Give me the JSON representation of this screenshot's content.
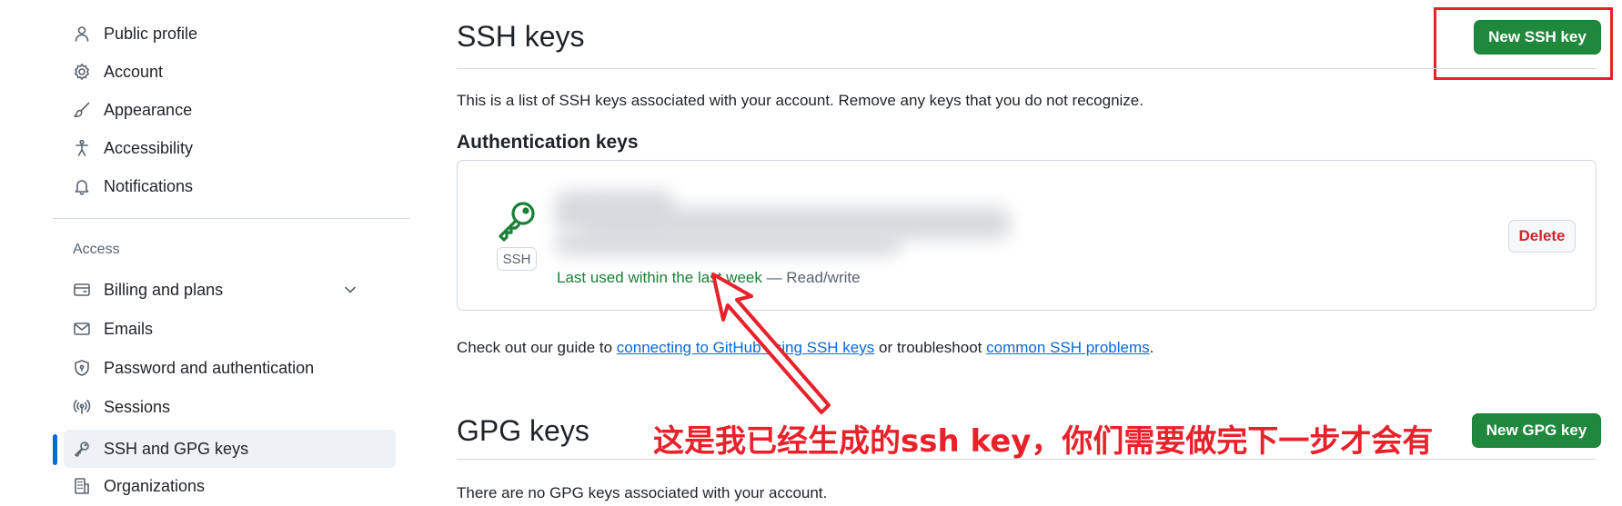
{
  "sidebar": {
    "items": [
      {
        "label": "Public profile",
        "icon": "person-icon"
      },
      {
        "label": "Account",
        "icon": "gear-icon"
      },
      {
        "label": "Appearance",
        "icon": "paintbrush-icon"
      },
      {
        "label": "Accessibility",
        "icon": "accessibility-icon"
      },
      {
        "label": "Notifications",
        "icon": "bell-icon"
      }
    ],
    "access_label": "Access",
    "access_items": [
      {
        "label": "Billing and plans",
        "icon": "credit-card-icon"
      },
      {
        "label": "Emails",
        "icon": "mail-icon"
      },
      {
        "label": "Password and authentication",
        "icon": "shield-lock-icon"
      },
      {
        "label": "Sessions",
        "icon": "broadcast-icon"
      },
      {
        "label": "SSH and GPG keys",
        "icon": "key-icon"
      },
      {
        "label": "Organizations",
        "icon": "organization-icon"
      }
    ]
  },
  "ssh": {
    "title": "SSH keys",
    "new_button": "New SSH key",
    "description": "This is a list of SSH keys associated with your account. Remove any keys that you do not recognize.",
    "auth_heading": "Authentication keys",
    "key": {
      "badge": "SSH",
      "last_used": "Last used within the last week",
      "access": " — Read/write",
      "delete_label": "Delete"
    },
    "guide_prefix": "Check out our guide to ",
    "guide_link": "connecting to GitHub using SSH keys",
    "guide_middle": " or troubleshoot ",
    "guide_link2": "common SSH problems",
    "guide_suffix": "."
  },
  "gpg": {
    "title": "GPG keys",
    "new_button": "New GPG key",
    "empty_text": "There are no GPG keys associated with your account."
  },
  "annotation": {
    "text": "这是我已经生成的ssh key，你们需要做完下一步才会有",
    "color": "#e8212a"
  },
  "colors": {
    "primary_green": "#1f883d",
    "link_blue": "#0969da",
    "danger_red": "#d1242f",
    "key_green": "#1a7f37"
  }
}
